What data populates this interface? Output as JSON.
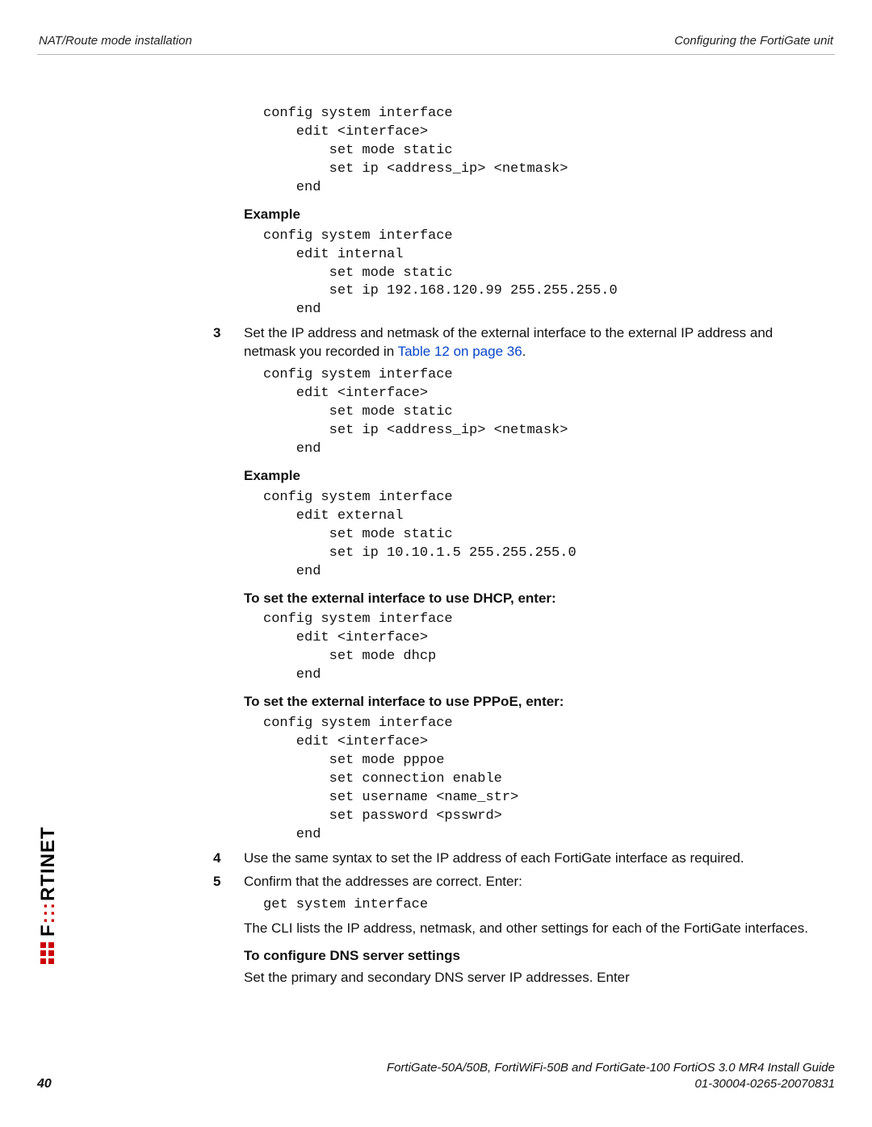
{
  "header": {
    "left": "NAT/Route mode installation",
    "right": "Configuring the FortiGate unit"
  },
  "code1": "config system interface\n    edit <interface>\n        set mode static\n        set ip <address_ip> <netmask>\n    end",
  "example_label": "Example",
  "code2": "config system interface\n    edit internal\n        set mode static\n        set ip 192.168.120.99 255.255.255.0\n    end",
  "step3": {
    "num": "3",
    "text_a": "Set the IP address and netmask of the external interface to the external IP address and netmask you recorded in ",
    "link": "Table 12 on page 36",
    "text_b": "."
  },
  "code3": "config system interface\n    edit <interface>\n        set mode static\n        set ip <address_ip> <netmask>\n    end",
  "code4": "config system interface\n    edit external\n        set mode static\n        set ip 10.10.1.5 255.255.255.0\n    end",
  "dhcp_label": "To set the external interface to use DHCP, enter:",
  "code5": "config system interface\n    edit <interface>\n        set mode dhcp\n    end",
  "pppoe_label": "To set the external interface to use PPPoE, enter:",
  "code6": "config system interface\n    edit <interface>\n        set mode pppoe\n        set connection enable\n        set username <name_str>\n        set password <psswrd>\n    end",
  "step4": {
    "num": "4",
    "text": "Use the same syntax to set the IP address of each FortiGate interface as required."
  },
  "step5": {
    "num": "5",
    "text": "Confirm that the addresses are correct. Enter:"
  },
  "code7": "get system interface",
  "cli_text": "The CLI lists the IP address, netmask, and other settings for each of the FortiGate interfaces.",
  "dns_label": "To configure DNS server settings",
  "dns_text": "Set the primary and secondary DNS server IP addresses. Enter",
  "footer": {
    "line1": "FortiGate-50A/50B, FortiWiFi-50B and FortiGate-100 FortiOS 3.0 MR4 Install Guide",
    "line2": "01-30004-0265-20070831",
    "page": "40"
  }
}
